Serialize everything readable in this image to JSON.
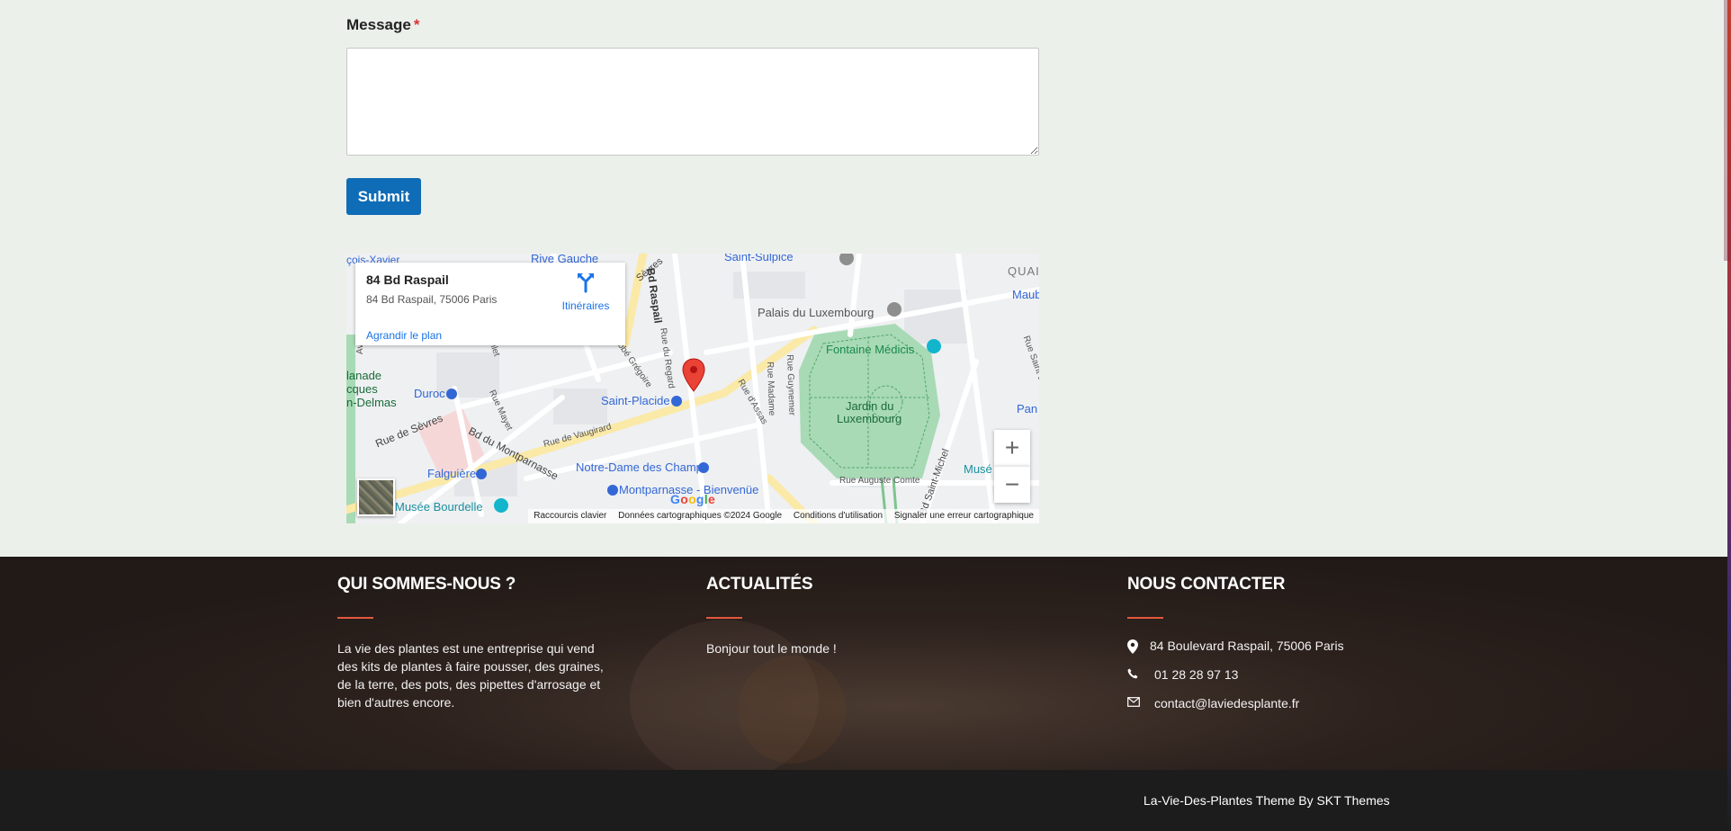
{
  "form": {
    "message_label": "Message",
    "required_mark": "*",
    "message_value": "",
    "submit_label": "Submit"
  },
  "map": {
    "place_title": "84 Bd Raspail",
    "place_address": "84 Bd Raspail, 75006 Paris",
    "directions_label": "Itinéraires",
    "enlarge_label": "Agrandir le plan",
    "zoom_in": "+",
    "zoom_out": "−",
    "google_logo": "Google",
    "attribution": {
      "shortcuts": "Raccourcis clavier",
      "data": "Données cartographiques ©2024 Google",
      "terms": "Conditions d'utilisation",
      "report": "Signaler une erreur cartographique"
    },
    "labels": {
      "rive_gauche": "Rive Gauche",
      "saint_sulpice": "Saint-Sulpice",
      "xavier": "çois-Xavier",
      "quai": "QUAI",
      "maub": "Maub",
      "palais": "Palais du Luxembourg",
      "fontaine": "Fontaine Médicis",
      "jardin_1": "Jardin du",
      "jardin_2": "Luxembourg",
      "bd_raspail": "Bd Raspail",
      "rue_du_regard": "Rue du Regard",
      "rue_sevres": "Rue de Sèvres",
      "sevres_top": "Sèvres",
      "duroc": "Duroc",
      "saint_placide": "Saint-Placide",
      "bd_montparnasse": "Bd du Montparnasse",
      "notre_dame": "Notre-Dame des Champs",
      "falguiere": "Falguière",
      "montparnasse": "Montparnasse - Bienvenüe",
      "musee_bourdelle": "Musée Bourdelle",
      "rue_vaugirard": "Rue de Vaugirard",
      "rue_auguste_comte": "Rue Auguste Comte",
      "bd_saint_michel": "Bd Saint-Michel",
      "esplanade_1": "lanade",
      "esplanade_2": "cques",
      "esplanade_3": "n-Delmas",
      "av_breteuil": "Av. de Breteuil",
      "pan": "Pan",
      "muse": "Musé",
      "rue_madame": "Rue Madame",
      "rue_guynemer": "Rue Guynemer",
      "rue_assas": "Rue d'Assas",
      "rue_mayet": "Rue Mayet",
      "abbe_gregoire": "bbé Grégoire",
      "rue_saint_j": "Rue Saint-J",
      "ilet": "ilet"
    }
  },
  "footer": {
    "about_heading": "QUI SOMMES-NOUS ?",
    "about_text": "La vie des plantes est une entreprise qui vend des kits de plantes à faire pousser, des graines, de la terre, des pots, des pipettes d'arrosage et bien d'autres encore.",
    "news_heading": "ACTUALITÉS",
    "news_item": "Bonjour tout le monde !",
    "contact_heading": "NOUS CONTACTER",
    "address": "84 Boulevard Raspail, 75006 Paris",
    "phone": "01 28 28 97 13",
    "email": "contact@laviedesplante.fr",
    "credits": "La-Vie-Des-Plantes Theme By SKT Themes"
  },
  "colors": {
    "background": "#ecf0eb",
    "submit": "#0f6cb6",
    "footer_accent": "#e4573d",
    "footer_bg": "#241c19",
    "bottom_bar": "#1c1c1c",
    "map_pin": "#ea4335",
    "park": "#a8dab5"
  },
  "icons": {
    "directions": "directions-icon",
    "address": "map-marker-icon",
    "phone": "phone-icon",
    "email": "envelope-icon",
    "map_pin": "map-pin-icon"
  }
}
